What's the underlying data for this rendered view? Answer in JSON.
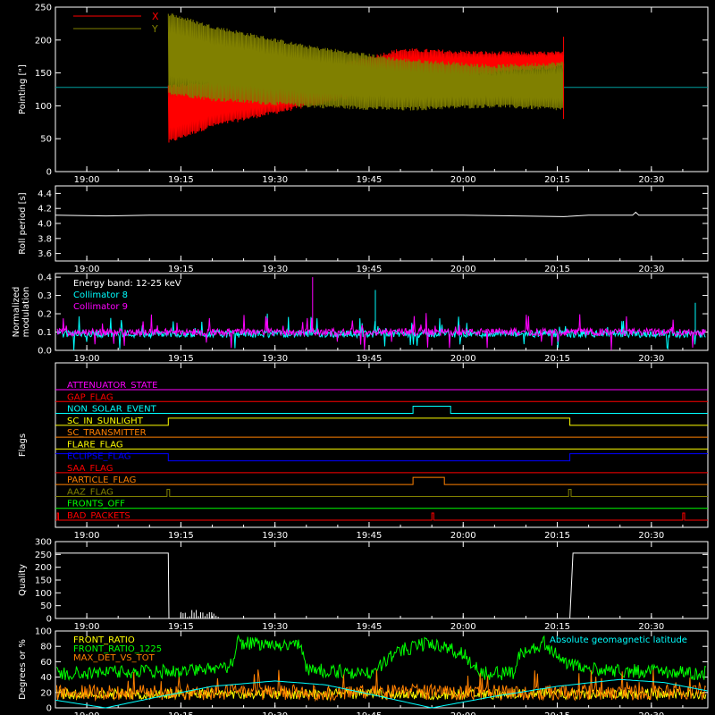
{
  "colors": {
    "background": "#000000",
    "axes": "#ffffff",
    "x": "#ff0000",
    "y": "#808000",
    "c8": "#00ffff",
    "c9": "#ff00ff",
    "attenuator": "#ff00ff",
    "gap": "#ff0000",
    "nonsolar": "#00ffff",
    "sunlight": "#ffff00",
    "transmitter": "#ff8000",
    "flare": "#ffff00",
    "eclipse": "#0000ff",
    "saa": "#ff0000",
    "particle": "#ff8000",
    "aaz": "#808000",
    "fronts": "#00ff00",
    "bad": "#ff0000",
    "ratio": "#ffff00",
    "ratio1225": "#00ff00",
    "maxdet": "#ff8000",
    "latitude": "#00ffff"
  },
  "time_axis": {
    "range": [
      "18:55",
      "20:39"
    ],
    "ticks": [
      "19:00",
      "19:15",
      "19:30",
      "19:45",
      "20:00",
      "20:15",
      "20:30"
    ]
  },
  "chart_data": [
    {
      "id": "pointing",
      "type": "line",
      "ylabel": "Pointing [\"]",
      "ylim": [
        0,
        250
      ],
      "yticks": [
        "0",
        "50",
        "100",
        "150",
        "200",
        "250"
      ],
      "legend_position": "top-left",
      "series": [
        {
          "name": "X",
          "color": "red",
          "envelope": [
            {
              "t": "19:13",
              "lo": 45,
              "hi": 130
            },
            {
              "t": "19:20",
              "lo": 70,
              "hi": 135
            },
            {
              "t": "19:35",
              "lo": 100,
              "hi": 150
            },
            {
              "t": "19:50",
              "lo": 130,
              "hi": 185
            },
            {
              "t": "20:05",
              "lo": 150,
              "hi": 180
            },
            {
              "t": "20:16",
              "lo": 160,
              "hi": 180
            }
          ]
        },
        {
          "name": "Y",
          "color": "olive",
          "envelope": [
            {
              "t": "19:13",
              "lo": 120,
              "hi": 240
            },
            {
              "t": "19:20",
              "lo": 110,
              "hi": 220
            },
            {
              "t": "19:35",
              "lo": 100,
              "hi": 190
            },
            {
              "t": "19:50",
              "lo": 95,
              "hi": 170
            },
            {
              "t": "20:05",
              "lo": 100,
              "hi": 160
            },
            {
              "t": "20:16",
              "lo": 95,
              "hi": 165
            }
          ]
        }
      ],
      "baseline": 128
    },
    {
      "id": "roll",
      "type": "line",
      "ylabel": "Roll period [s]",
      "ylim": [
        3.5,
        4.5
      ],
      "yticks": [
        "3.6",
        "3.8",
        "4.0",
        "4.2",
        "4.4"
      ],
      "points": [
        {
          "t": "18:55",
          "y": 4.11
        },
        {
          "t": "19:03",
          "y": 4.1
        },
        {
          "t": "19:10",
          "y": 4.11
        },
        {
          "t": "19:20",
          "y": 4.11
        },
        {
          "t": "19:50",
          "y": 4.11
        },
        {
          "t": "20:00",
          "y": 4.11
        },
        {
          "t": "20:16",
          "y": 4.09
        },
        {
          "t": "20:20",
          "y": 4.11
        },
        {
          "t": "20:27",
          "y": 4.11
        },
        {
          "t": "20:27.5",
          "y": 4.15
        },
        {
          "t": "20:28",
          "y": 4.11
        },
        {
          "t": "20:39",
          "y": 4.11
        }
      ]
    },
    {
      "id": "modulation",
      "type": "line",
      "ylabel": [
        "Normalized",
        "modulation"
      ],
      "ylim": [
        0,
        0.42
      ],
      "yticks": [
        "0.0",
        "0.1",
        "0.2",
        "0.3",
        "0.4"
      ],
      "legend_position": "top-left",
      "legend_title": "Energy band: 12-25 keV",
      "series": [
        {
          "name": "Collimator 8",
          "color": "cyan",
          "level": 0.09
        },
        {
          "name": "Collimator 9",
          "color": "magenta",
          "level": 0.1
        }
      ]
    },
    {
      "id": "flags",
      "type": "step",
      "ylabel": "Flags",
      "flags": [
        {
          "label": "ATTENUATOR_STATE",
          "key": "attenuator",
          "on": []
        },
        {
          "label": "GAP_FLAG",
          "key": "gap",
          "on": []
        },
        {
          "label": "NON_SOLAR_EVENT",
          "key": "nonsolar",
          "on": [
            [
              "19:52",
              "19:58"
            ]
          ]
        },
        {
          "label": "SC_IN_SUNLIGHT",
          "key": "sunlight",
          "on": [
            [
              "19:13",
              "20:17"
            ]
          ]
        },
        {
          "label": "SC_TRANSMITTER",
          "key": "transmitter",
          "on": []
        },
        {
          "label": "FLARE_FLAG",
          "key": "flare",
          "on": []
        },
        {
          "label": "ECLIPSE_FLAG",
          "key": "eclipse",
          "on": [
            [
              "18:55",
              "19:13"
            ],
            [
              "20:17",
              "20:39"
            ]
          ]
        },
        {
          "label": "SAA_FLAG",
          "key": "saa",
          "on": []
        },
        {
          "label": "PARTICLE_FLAG",
          "key": "particle",
          "on": [
            [
              "19:52",
              "19:57"
            ]
          ]
        },
        {
          "label": "AAZ_FLAG",
          "key": "aaz",
          "on": [
            [
              "19:12.8",
              "19:13.2"
            ],
            [
              "20:16.8",
              "20:17.2"
            ]
          ]
        },
        {
          "label": "FRONTS_OFF",
          "key": "fronts",
          "on": []
        },
        {
          "label": "BAD_PACKETS",
          "key": "bad",
          "on": [
            [
              "18:55.3",
              "18:55.5"
            ],
            [
              "19:55",
              "19:55.3"
            ],
            [
              "20:35",
              "20:35.3"
            ]
          ]
        }
      ]
    },
    {
      "id": "quality",
      "type": "line",
      "ylabel": "Quality",
      "ylim": [
        0,
        300
      ],
      "yticks": [
        "0",
        "50",
        "100",
        "150",
        "200",
        "250",
        "300"
      ],
      "points": [
        {
          "t": "18:55",
          "y": 255
        },
        {
          "t": "19:13",
          "y": 255
        },
        {
          "t": "19:13.1",
          "y": 0
        },
        {
          "t": "20:17",
          "y": 0
        },
        {
          "t": "20:17.5",
          "y": 255
        },
        {
          "t": "20:39",
          "y": 255
        }
      ]
    },
    {
      "id": "ratios",
      "type": "line",
      "ylabel": "Degrees or %",
      "ylim": [
        0,
        100
      ],
      "yticks": [
        "0",
        "20",
        "40",
        "60",
        "80",
        "100"
      ],
      "legend_position": "top-left",
      "annotation": "Absolute geomagnetic latitude",
      "series": [
        {
          "name": "FRONT_RATIO",
          "color": "yellow"
        },
        {
          "name": "FRONT_RATIO_1225",
          "color": "green",
          "points": [
            {
              "t": "18:55",
              "y": 45
            },
            {
              "t": "19:17",
              "y": 48
            },
            {
              "t": "19:23",
              "y": 55
            },
            {
              "t": "19:24",
              "y": 85
            },
            {
              "t": "19:34",
              "y": 80
            },
            {
              "t": "19:35",
              "y": 50
            },
            {
              "t": "19:45",
              "y": 45
            },
            {
              "t": "19:50",
              "y": 75
            },
            {
              "t": "19:55",
              "y": 85
            },
            {
              "t": "20:00",
              "y": 70
            },
            {
              "t": "20:03",
              "y": 45
            },
            {
              "t": "20:08",
              "y": 45
            },
            {
              "t": "20:09",
              "y": 70
            },
            {
              "t": "20:13",
              "y": 85
            },
            {
              "t": "20:16",
              "y": 60
            },
            {
              "t": "20:19",
              "y": 50
            },
            {
              "t": "20:39",
              "y": 45
            }
          ]
        },
        {
          "name": "MAX_DET_VS_TOT",
          "color": "orange",
          "level": 20
        },
        {
          "name": "Absolute geomagnetic latitude",
          "color": "cyan",
          "points": [
            {
              "t": "18:55",
              "y": 10
            },
            {
              "t": "19:03",
              "y": 0
            },
            {
              "t": "19:10",
              "y": 12
            },
            {
              "t": "19:20",
              "y": 28
            },
            {
              "t": "19:30",
              "y": 35
            },
            {
              "t": "19:38",
              "y": 30
            },
            {
              "t": "19:45",
              "y": 18
            },
            {
              "t": "19:55",
              "y": 0
            },
            {
              "t": "20:05",
              "y": 15
            },
            {
              "t": "20:15",
              "y": 28
            },
            {
              "t": "20:25",
              "y": 37
            },
            {
              "t": "20:32",
              "y": 33
            },
            {
              "t": "20:39",
              "y": 22
            }
          ]
        }
      ]
    }
  ]
}
